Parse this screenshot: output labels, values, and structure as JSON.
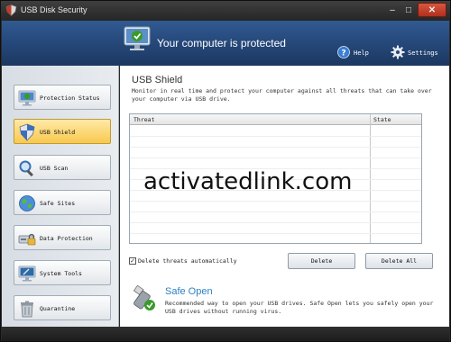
{
  "window": {
    "title": "USB Disk Security",
    "minimize": "–",
    "maximize": "□",
    "close": "✕"
  },
  "header": {
    "status_text": "Your computer is protected",
    "help_label": "Help",
    "settings_label": "Settings"
  },
  "sidebar": {
    "items": [
      {
        "label": "Protection Status",
        "icon": "monitor-check-icon",
        "active": false
      },
      {
        "label": "USB Shield",
        "icon": "shield-icon",
        "active": true
      },
      {
        "label": "USB Scan",
        "icon": "magnifier-icon",
        "active": false
      },
      {
        "label": "Safe Sites",
        "icon": "globe-icon",
        "active": false
      },
      {
        "label": "Data Protection",
        "icon": "drive-lock-icon",
        "active": false
      },
      {
        "label": "System Tools",
        "icon": "monitor-tools-icon",
        "active": false
      },
      {
        "label": "Quarantine",
        "icon": "trash-icon",
        "active": false
      }
    ]
  },
  "main": {
    "title": "USB Shield",
    "description": "Monitor in real time and protect your computer against all threats that can take over your computer via USB drive.",
    "table": {
      "columns": [
        "Threat",
        "State"
      ],
      "rows": []
    },
    "auto_delete": {
      "label": "Delete threats automatically",
      "checked": true
    },
    "buttons": {
      "delete": "Delete",
      "delete_all": "Delete All"
    },
    "safe_open": {
      "title": "Safe Open",
      "description": "Recommended way to open your USB drives. Safe Open lets you safely open your USB drives without running virus."
    }
  },
  "overlay": {
    "watermark": "activatedlink.com"
  },
  "colors": {
    "header_blue": "#244677",
    "active_tab": "#f8c94e",
    "safe_open_title": "#2e7fc2",
    "status_green": "#3a9a2a"
  }
}
